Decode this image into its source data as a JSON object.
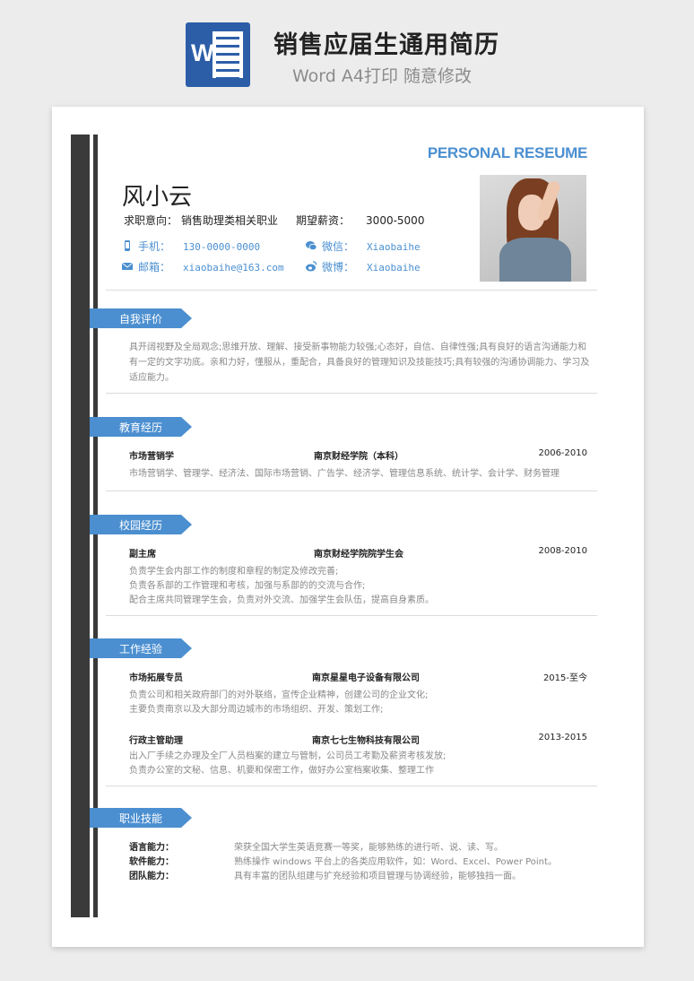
{
  "banner": {
    "icon_letter": "W",
    "title": "销售应届生通用简历",
    "subtitle": "Word A4打印 随意修改"
  },
  "header": {
    "personal_title": "PERSONAL RESEUME",
    "name": "风小云",
    "intent_label": "求职意向：",
    "intent_value": "销售助理类相关职业",
    "salary_label": "期望薪资：",
    "salary_value": "3000-5000",
    "phone_label": "手机：",
    "phone_value": "130-0000-0000",
    "email_label": "邮箱：",
    "email_value": "xiaobaihe@163.com",
    "wechat_label": "微信：",
    "wechat_value": "Xiaobaihe",
    "weibo_label": "微博：",
    "weibo_value": "Xiaobaihe",
    "accent_color": "#4b8fd0"
  },
  "sections": {
    "self_eval": {
      "title": "自我评价",
      "text": "具开阔视野及全局观念;思维开放、理解、接受新事物能力较强;心态好，自信、自律性强;具有良好的语言沟通能力和有一定的文字功底。亲和力好，懂服从，重配合，具备良好的管理知识及技能技巧;具有较强的沟通协调能力、学习及适应能力。"
    },
    "education": {
      "title": "教育经历",
      "major": "市场营销学",
      "school": "南京财经学院（本科）",
      "date": "2006-2010",
      "courses": "市场营销学、管理学、经济法、国际市场营销、广告学、经济学、管理信息系统、统计学、会计学、财务管理"
    },
    "campus": {
      "title": "校园经历",
      "role": "副主席",
      "org": "南京财经学院院学生会",
      "date": "2008-2010",
      "lines": [
        "负责学生会内部工作的制度和章程的制定及修改完善;",
        "负责各系部的工作管理和考核，加强与系部的的交流与合作;",
        "配合主席共同管理学生会，负责对外交流、加强学生会队伍，提高自身素质。"
      ]
    },
    "work": {
      "title": "工作经验",
      "jobs": [
        {
          "role": "市场拓展专员",
          "company": "南京星星电子设备有限公司",
          "date": "2015-至今",
          "lines": [
            "负责公司和相关政府部门的对外联络，宣传企业精神，创建公司的企业文化;",
            "主要负责南京以及大部分周边城市的市场组织、开发、策划工作;"
          ]
        },
        {
          "role": "行政主管助理",
          "company": "南京七七生物科技有限公司",
          "date": "2013-2015",
          "lines": [
            "出入厂手续之办理及全厂人员档案的建立与管制，公司员工考勤及薪资考核发放;",
            "负责办公室的文秘、信息、机要和保密工作，做好办公室档案收集、整理工作"
          ]
        }
      ]
    },
    "skills": {
      "title": "职业技能",
      "items": [
        {
          "label": "语言能力：",
          "value": "荣获全国大学生英语竞赛一等奖，能够熟练的进行听、说、读、写。"
        },
        {
          "label": "软件能力：",
          "value": "熟练操作 windows 平台上的各类应用软件，如：Word、Excel、Power Point。"
        },
        {
          "label": "团队能力：",
          "value": "具有丰富的团队组建与扩充经验和项目管理与协调经验，能够独挡一面。"
        }
      ]
    }
  }
}
